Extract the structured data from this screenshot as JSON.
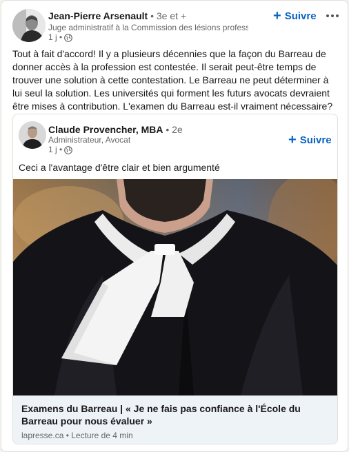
{
  "post": {
    "actor": {
      "name": "Jean-Pierre Arsenault",
      "degree": "• 3e et +",
      "headline": "Juge administratif à la Commission des lésions professionn...",
      "time": "1 j •"
    },
    "follow_label": "Suivre",
    "text": "Tout à fait d'accord! Il y a plusieurs décennies que la façon du Barreau de donner accès à la profession est contestée. Il serait peut-être temps de trouver une solution à cette contestation. Le Barreau ne peut déterminer à lui seul la solution. Les universités qui forment les futurs avocats devraient être mises à contribution. L'examen du Barreau est-il vraiment nécessaire?"
  },
  "shared": {
    "actor": {
      "name": "Claude Provencher, MBA",
      "degree": "• 2e",
      "headline": "Administrateur, Avocat",
      "time": "1 j •"
    },
    "follow_label": "Suivre",
    "text": "Ceci a l'avantage d'être clair et bien argumenté",
    "article": {
      "title": "Examens du Barreau | « Je ne fais pas confiance à l'École du Barreau pour nous évaluer »",
      "source": "lapresse.ca • Lecture de 4 min"
    }
  },
  "icons": {
    "follow": "plus-icon",
    "more": "ellipsis-icon",
    "visibility": "globe-icon"
  },
  "colors": {
    "accent": "#0a66c2",
    "muted_text": "#666666",
    "article_footer_bg": "#eef3f8"
  }
}
